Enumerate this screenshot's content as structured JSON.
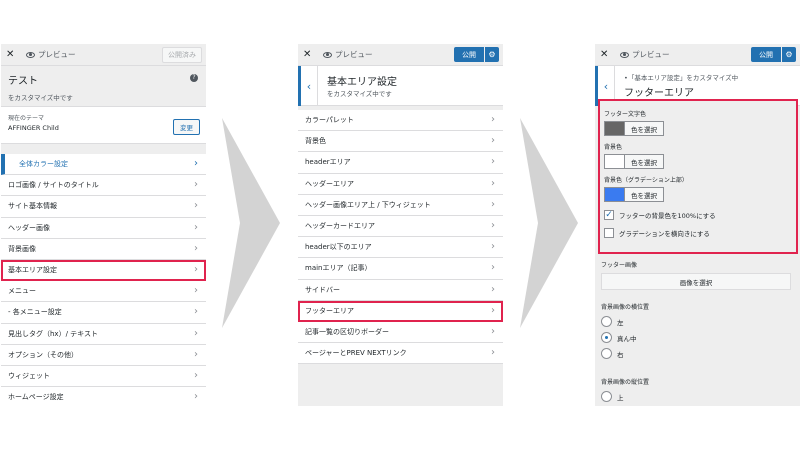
{
  "common": {
    "close": "✕",
    "preview": "プレビュー",
    "gear": "⚙"
  },
  "panel1": {
    "publish": "公開済み",
    "title": "テスト",
    "subtitle": "をカスタマイズ中です",
    "help": "?",
    "theme_label": "現在のテーマ",
    "theme_name": "AFFINGER Child",
    "change": "変更",
    "items": [
      "全体カラー設定",
      "ロゴ画像 / サイトのタイトル",
      "サイト基本情報",
      "ヘッダー画像",
      "背景画像",
      "基本エリア設定",
      "メニュー",
      "- 各メニュー設定",
      "見出しタグ（hx）/ テキスト",
      "オプション（その他）",
      "ウィジェット",
      "ホームページ設定"
    ]
  },
  "panel2": {
    "publish": "公開",
    "title": "基本エリア設定",
    "subtitle": "をカスタマイズ中です",
    "items": [
      "カラーパレット",
      "背景色",
      "headerエリア",
      "ヘッダーエリア",
      "ヘッダー画像エリア上 / 下ウィジェット",
      "ヘッダーカードエリア",
      "header以下のエリア",
      "mainエリア（記事）",
      "サイドバー",
      "フッターエリア",
      "記事一覧の区切りボーダー",
      "ページャーとPREV NEXTリンク"
    ]
  },
  "panel3": {
    "publish": "公開",
    "subtitle": "•「基本エリア設定」をカスタマイズ中",
    "title": "フッターエリア",
    "footer_text_color": "フッター文字色",
    "select_color": "色を選択",
    "bg_color": "背景色",
    "bg_gradient": "背景色（グラデーション上部）",
    "check_full": "フッターの背景色を100%にする",
    "check_horizontal": "グラデーションを横向きにする",
    "footer_image": "フッター画像",
    "select_image": "画像を選択",
    "bg_h_pos": "背景画像の横位置",
    "left": "左",
    "center": "真ん中",
    "right": "右",
    "bg_v_pos": "背景画像の縦位置",
    "top": "上",
    "colors": {
      "text": "#666666",
      "bg": "#ffffff",
      "gradient": "#3a7bf0"
    }
  }
}
